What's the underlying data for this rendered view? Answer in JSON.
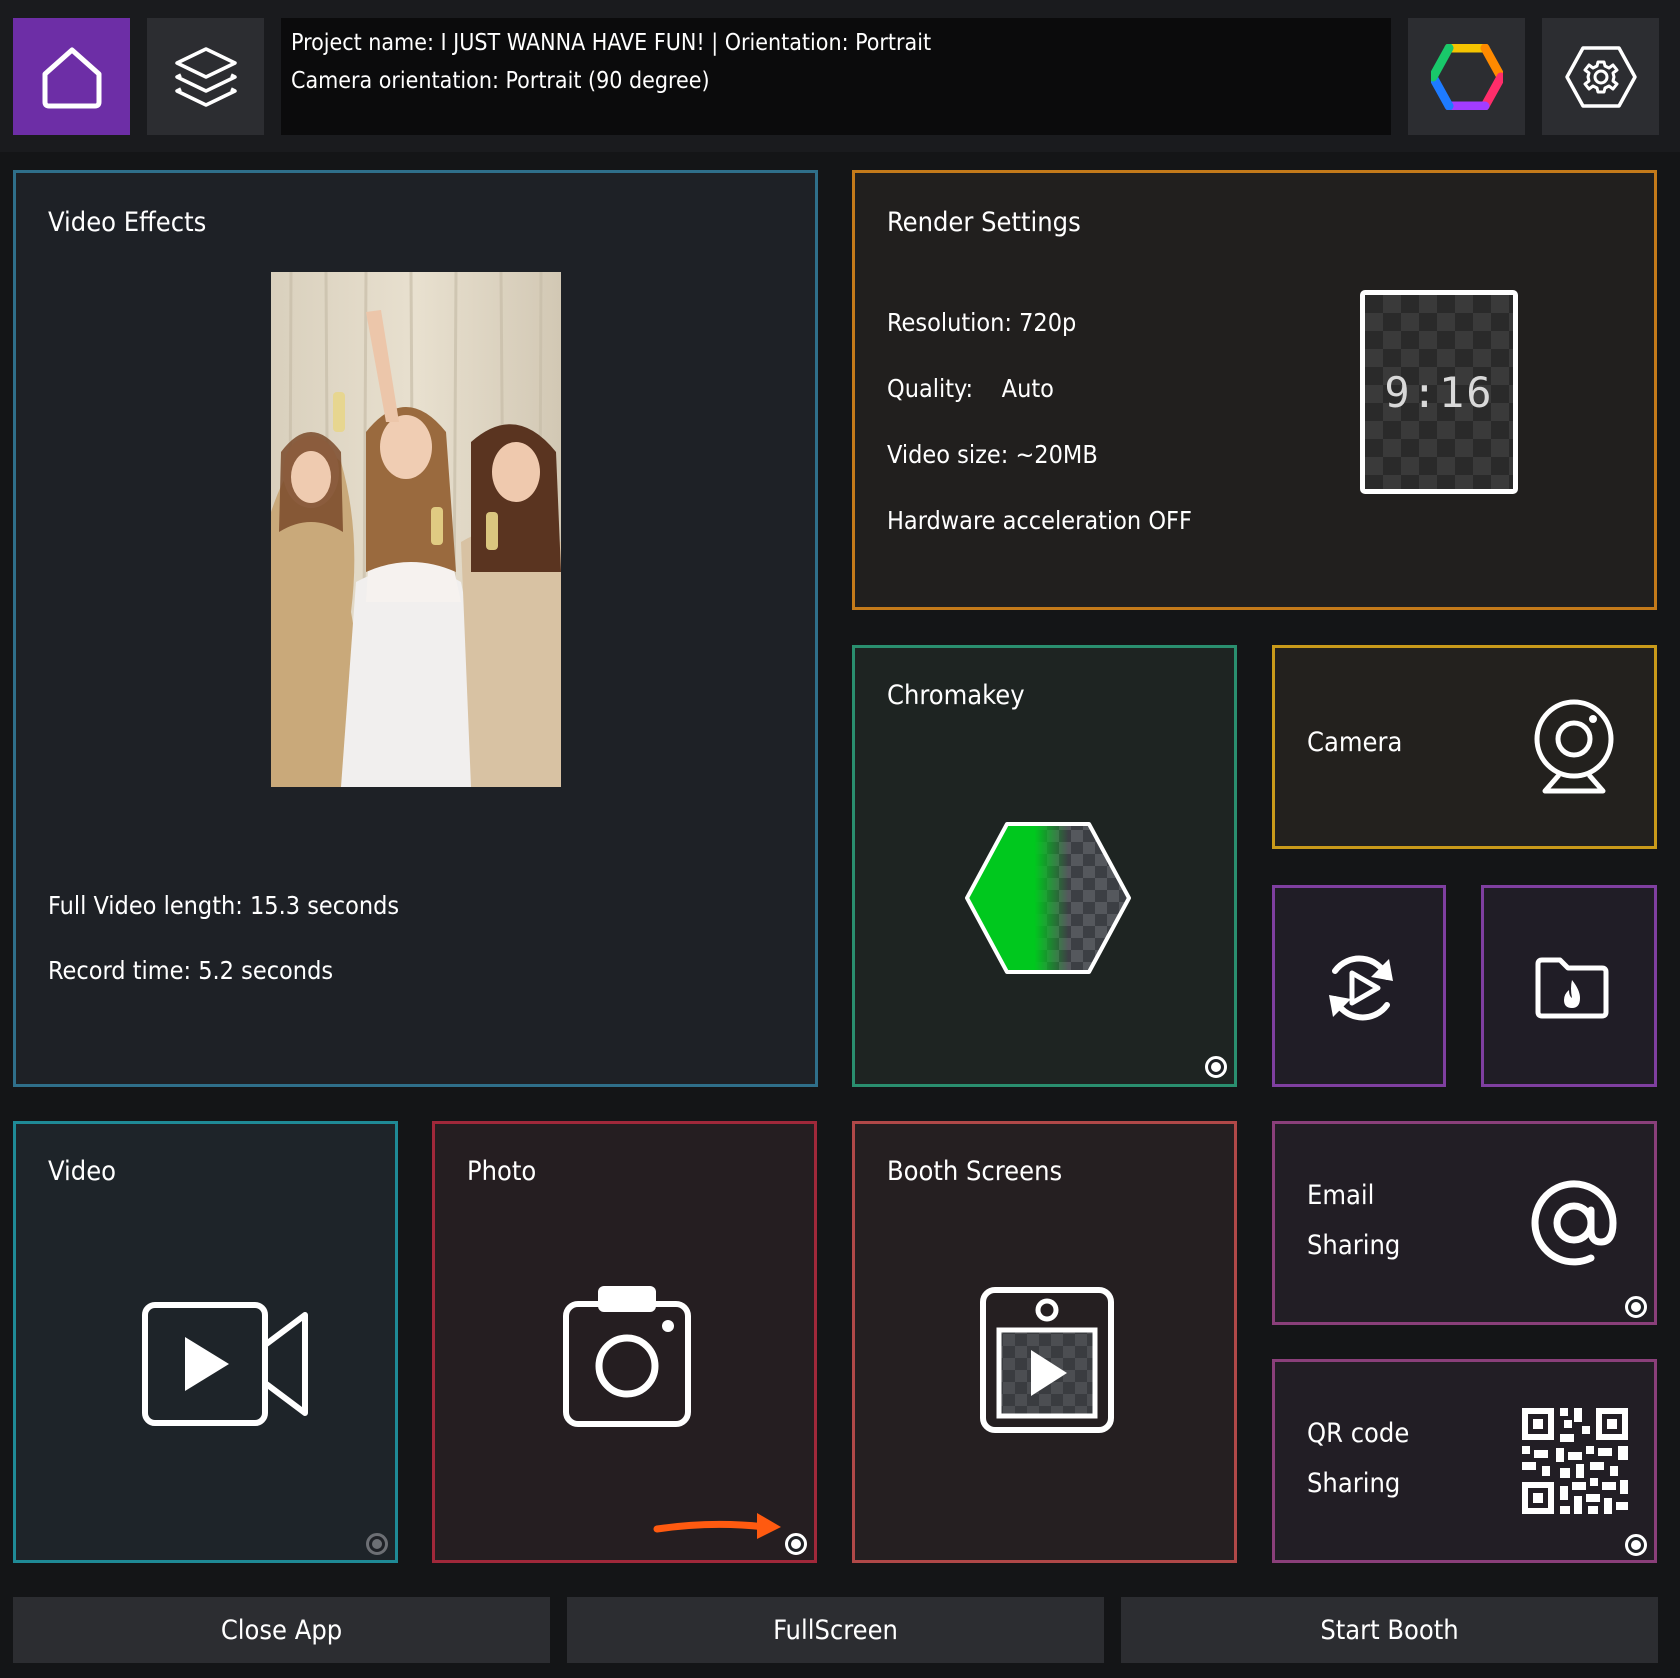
{
  "header": {
    "project_line": "Project name: I JUST WANNA HAVE FUN! | Orientation: Portrait",
    "camera_line": "Camera orientation: Portrait (90 degree)",
    "icons": [
      "home-icon",
      "layers-icon",
      "color-hexagon-icon",
      "gear-icon"
    ]
  },
  "video_effects": {
    "title": "Video Effects",
    "full_length": "Full Video length: 15.3 seconds",
    "record_time": "Record time:  5.2 seconds"
  },
  "render_settings": {
    "title": "Render Settings",
    "resolution": "Resolution: 720p",
    "quality": "Quality:    Auto",
    "video_size": "Video size: ~20MB",
    "hw_accel": "Hardware acceleration OFF",
    "aspect": "9:16"
  },
  "chromakey": {
    "title": "Chromakey"
  },
  "camera": {
    "title": "Camera"
  },
  "video": {
    "title": "Video"
  },
  "photo": {
    "title": "Photo"
  },
  "booth_screens": {
    "title": "Booth Screens"
  },
  "email": {
    "line1": "Email",
    "line2": "Sharing"
  },
  "qr": {
    "line1": "QR code",
    "line2": "Sharing"
  },
  "footer": {
    "close": "Close App",
    "fullscreen": "FullScreen",
    "start": "Start Booth"
  },
  "colors": {
    "video_effects_border": "#2f6f8a",
    "render_border": "#c47a1a",
    "chromakey_border": "#2a8f6f",
    "camera_border": "#c99a1a",
    "purple_border": "#7f3fa0",
    "video_border": "#1f8a96",
    "photo_border": "#a0283a",
    "booth_border": "#b04848",
    "sharing_border": "#8a3f7a",
    "home_active": "#6d2ea6",
    "arrow": "#ff5a10"
  }
}
